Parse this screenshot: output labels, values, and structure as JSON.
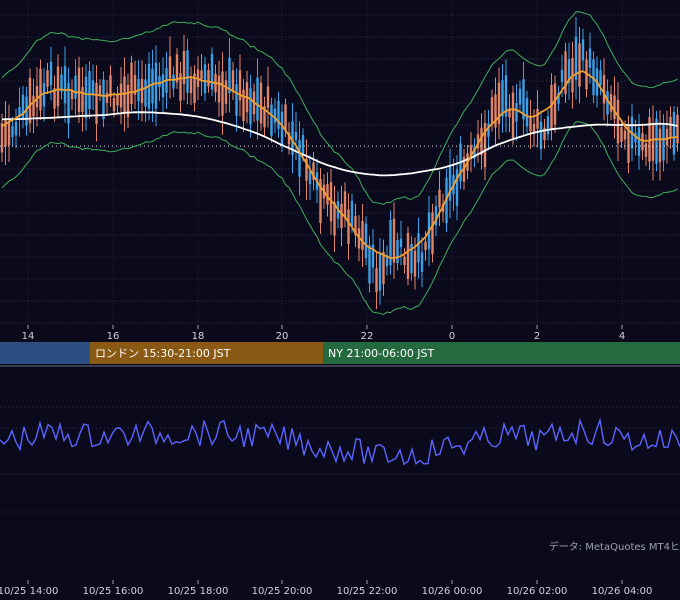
{
  "chart_data": [
    {
      "type": "candlestick",
      "title": "",
      "x_tick_labels": [
        "14",
        "16",
        "18",
        "20",
        "22",
        "0",
        "2",
        "4"
      ],
      "overlays": [
        "Bollinger Bands",
        "Moving Average (orange)",
        "Moving Average (white)"
      ],
      "colors": {
        "up": "#3aa0e8",
        "down": "#e0856a",
        "bands": "#3fae5a",
        "ma_short": "#f0a030",
        "ma_long": "#ffffff",
        "baseline": "#ffffff"
      },
      "series_hint": "intraday price, rises 14:00–19:30, falls to low near 22:30, rebounds after 0:00",
      "grid": true
    },
    {
      "type": "line",
      "title": "",
      "x_tick_labels": [
        "10/25 14:00",
        "10/25 16:00",
        "10/25 18:00",
        "10/25 20:00",
        "10/25 22:00",
        "10/26 00:00",
        "10/26 02:00",
        "10/26 04:00"
      ],
      "colors": {
        "line": "#5a64ff"
      },
      "grid": true
    }
  ],
  "sessions": [
    {
      "label": "",
      "color": "#2b4f80"
    },
    {
      "label": "ロンドン 15:30-21:00 JST",
      "color": "#8a5a14"
    },
    {
      "label": "NY 21:00-06:00 JST",
      "color": "#256a3e"
    }
  ],
  "source_note": "データ: MetaQuotes MT4ヒ"
}
